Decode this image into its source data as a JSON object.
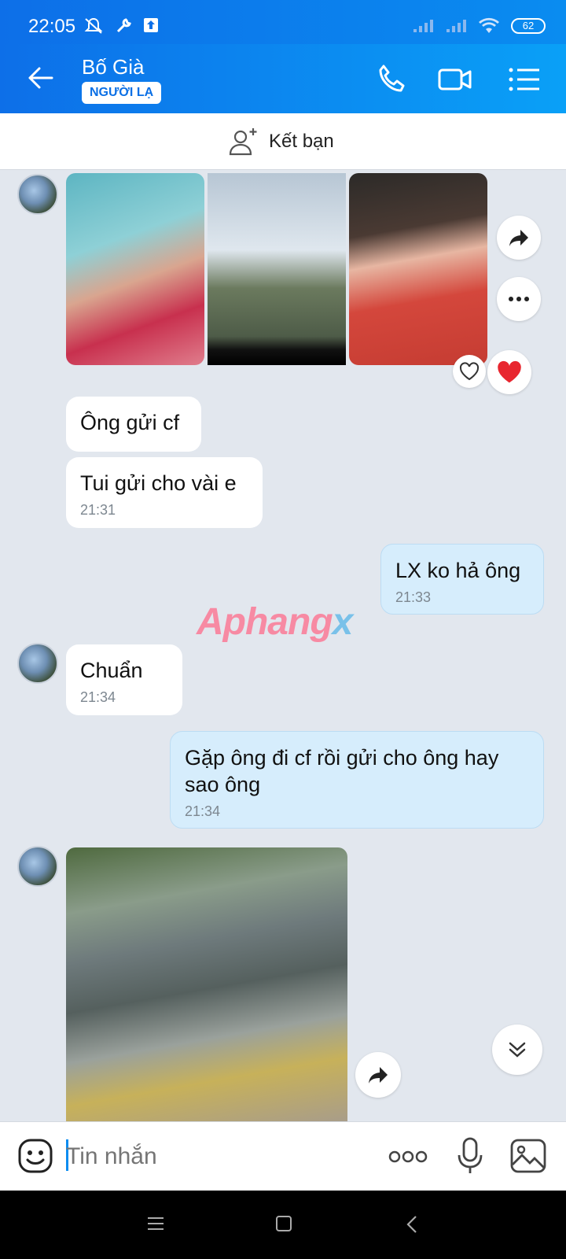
{
  "status_bar": {
    "time": "22:05",
    "battery": "62"
  },
  "header": {
    "title": "Bố Già",
    "badge": "NGƯỜI LẠ"
  },
  "friend_bar": {
    "label": "Kết bạn"
  },
  "messages": [
    {
      "id": "m1",
      "text": "Ông gửi cf",
      "time": ""
    },
    {
      "id": "m2",
      "text": "Tui gửi cho vài e",
      "time": "21:31"
    },
    {
      "id": "m3",
      "text": "LX ko hả ông",
      "time": "21:33",
      "sender": "me"
    },
    {
      "id": "m4",
      "text": "Chuẩn",
      "time": "21:34"
    },
    {
      "id": "m5",
      "text": "Gặp ông đi cf rồi gửi cho ông hay sao ông",
      "time": "21:34",
      "sender": "me"
    }
  ],
  "watermark": {
    "part1": "Aphang",
    "part2": "x"
  },
  "input": {
    "placeholder": "Tin nhắn"
  },
  "colors": {
    "header": "#0d6fe8",
    "my_bubble": "#d6edfc",
    "heart": "#e8262f"
  },
  "icons": [
    "back-arrow-icon",
    "phone-icon",
    "video-icon",
    "menu-icon",
    "add-friend-icon",
    "share-icon",
    "more-icon",
    "heart-outline-icon",
    "heart-filled-icon",
    "scroll-down-icon",
    "sticker-icon",
    "ellipsis-icon",
    "microphone-icon",
    "image-icon"
  ]
}
